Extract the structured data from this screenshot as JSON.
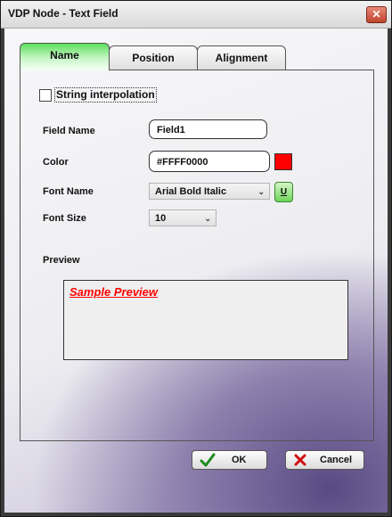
{
  "window": {
    "title": "VDP Node - Text Field",
    "close_glyph": "✕"
  },
  "tabs": [
    {
      "label": "Name",
      "active": true
    },
    {
      "label": "Position",
      "active": false
    },
    {
      "label": "Alignment",
      "active": false
    }
  ],
  "form": {
    "string_interpolation": {
      "label": "String interpolation",
      "checked": false
    },
    "field_name": {
      "label": "Field Name",
      "value": "Field1"
    },
    "color": {
      "label": "Color",
      "value": "#FFFF0000",
      "swatch": "#ff0000"
    },
    "font_name": {
      "label": "Font Name",
      "value": "Arial Bold Italic",
      "underline_toggle": "U"
    },
    "font_size": {
      "label": "Font Size",
      "value": "10"
    },
    "preview": {
      "label": "Preview",
      "text": "Sample Preview",
      "text_color": "#ff0000"
    }
  },
  "buttons": {
    "ok": "OK",
    "cancel": "Cancel"
  },
  "icons": {
    "ok": "checkmark-icon",
    "cancel": "x-icon",
    "dropdown": "chevron-down-icon"
  },
  "colors": {
    "active_tab": "#5de05d",
    "preview_text": "#ff0000"
  }
}
